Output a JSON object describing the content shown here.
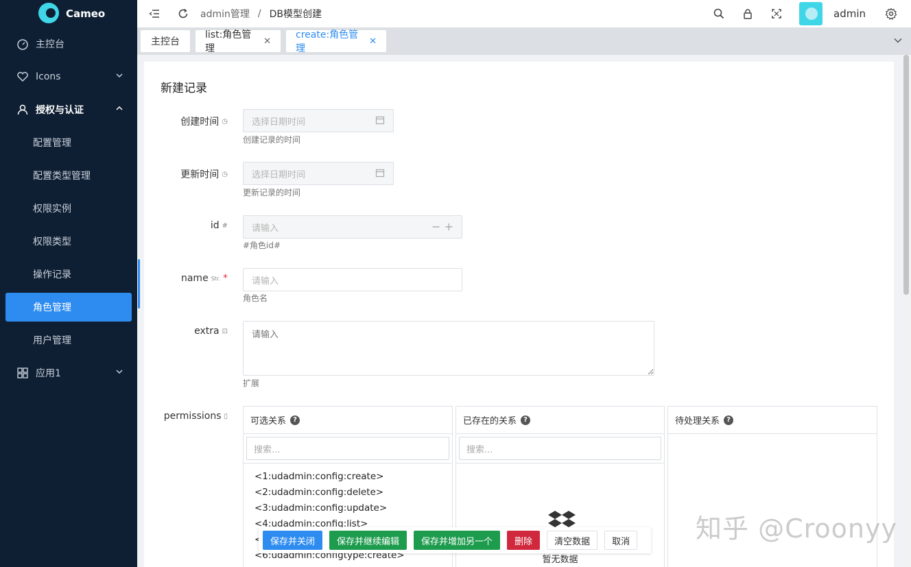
{
  "app": {
    "name": "Cameo"
  },
  "sidebar": {
    "items": [
      {
        "label": "主控台",
        "icon": "dashboard-icon"
      },
      {
        "label": "Icons",
        "icon": "heart-icon"
      },
      {
        "label": "授权与认证",
        "icon": "user-icon"
      },
      {
        "label": "应用1",
        "icon": "grid-icon"
      }
    ],
    "auth_children": [
      "配置管理",
      "配置类型管理",
      "权限实例",
      "权限类型",
      "操作记录",
      "角色管理",
      "用户管理"
    ],
    "active": "角色管理"
  },
  "header": {
    "breadcrumb": [
      "admin管理",
      "DB模型创建"
    ],
    "username": "admin"
  },
  "tabs": [
    {
      "label": "主控台",
      "closable": false
    },
    {
      "label": "list:角色管理",
      "closable": true
    },
    {
      "label": "create:角色管理",
      "closable": true,
      "active": true
    }
  ],
  "form": {
    "title": "新建记录",
    "fields": {
      "created": {
        "label": "创建时间",
        "placeholder": "选择日期时间",
        "help": "创建记录的时间"
      },
      "updated": {
        "label": "更新时间",
        "placeholder": "选择日期时间",
        "help": "更新记录的时间"
      },
      "id": {
        "label": "id",
        "placeholder": "请输入",
        "help": "#角色id#"
      },
      "name": {
        "label": "name",
        "type_hint": "Str.",
        "placeholder": "请输入",
        "help": "角色名"
      },
      "extra": {
        "label": "extra",
        "placeholder": "请输入",
        "help": "扩展"
      },
      "permissions": {
        "label": "permissions"
      }
    },
    "permissions": {
      "available": {
        "title": "可选关系",
        "search_placeholder": "搜索...",
        "options": [
          "<1:udadmin:config:create>",
          "<2:udadmin:config:delete>",
          "<3:udadmin:config:update>",
          "<4:udadmin:config:list>",
          "<",
          "<6:udadmin:configtype:create>"
        ]
      },
      "existing": {
        "title": "已存在的关系",
        "search_placeholder": "搜索...",
        "empty_text": "暂无数据"
      },
      "pending": {
        "title": "待处理关系"
      }
    }
  },
  "actions": {
    "save_close": "保存并关闭",
    "save_continue": "保存并继续编辑",
    "save_add_another": "保存并增加另一个",
    "delete": "删除",
    "clear": "清空数据",
    "cancel": "取消"
  },
  "watermark": "知乎 @Croonyy",
  "colors": {
    "sidebar_bg": "#0f1f33",
    "accent": "#2e8cf0",
    "success": "#1e9c4e",
    "danger": "#d0283c"
  }
}
